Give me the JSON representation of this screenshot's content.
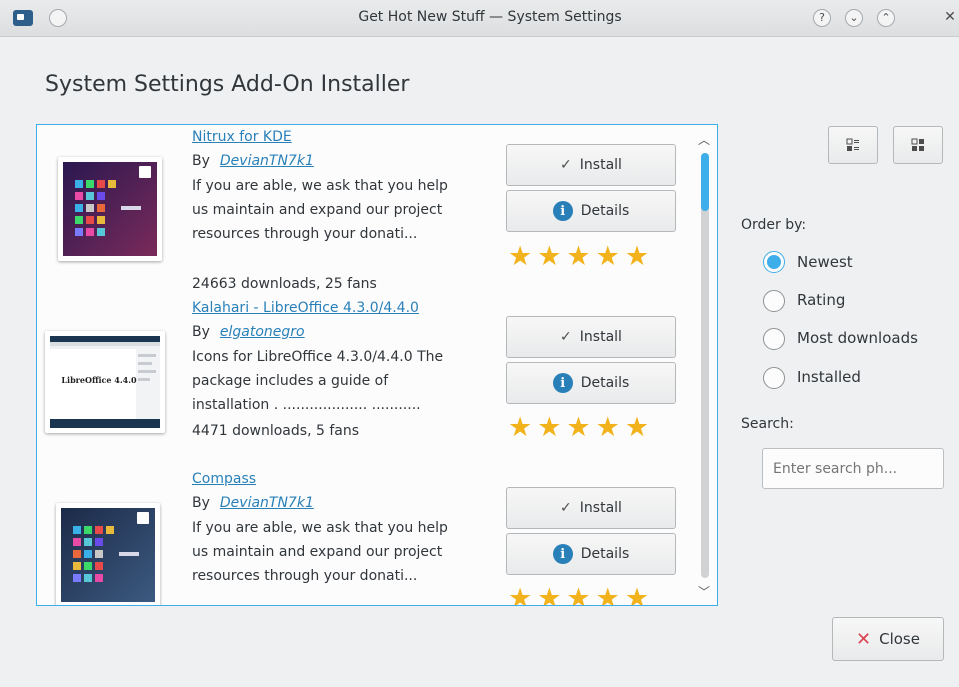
{
  "window": {
    "title": "Get Hot New Stuff — System Settings"
  },
  "heading": "System Settings Add-On Installer",
  "items": [
    {
      "name": "Nitrux for KDE",
      "by_label": "By",
      "author": "DevianTN7k1",
      "description": "If you are able, we ask that you help us maintain and expand our project resources through your donati...",
      "stats": "24663 downloads, 25 fans",
      "install_label": "Install",
      "details_label": "Details",
      "rating_stars": 5
    },
    {
      "name": " Kalahari - LibreOffice 4.3.0/4.4.0",
      "by_label": "By",
      "author": "elgatonegro",
      "description": "Icons for LibreOffice 4.3.0/4.4.0 The package includes a guide of installation . ................... ...........",
      "stats": "4471 downloads, 5 fans",
      "thumb_text": "LibreOffice 4.4.0",
      "install_label": "Install",
      "details_label": "Details",
      "rating_stars": 5
    },
    {
      "name": "Compass",
      "by_label": "By",
      "author": "DevianTN7k1",
      "description": "If you are able, we ask that you help us maintain and expand our project resources through your donati...",
      "stats": "",
      "install_label": "Install",
      "details_label": "Details",
      "rating_stars": 5
    }
  ],
  "sidebar": {
    "order_by_label": "Order by:",
    "order_options": [
      "Newest",
      "Rating",
      "Most downloads",
      "Installed"
    ],
    "selected": "Newest",
    "search_label": "Search:",
    "search_placeholder": "Enter search ph..."
  },
  "close_label": "Close",
  "colors": {
    "accent": "#3daee9",
    "link": "#2980b9",
    "star": "#f2b21b",
    "close_icon": "#da4453"
  }
}
